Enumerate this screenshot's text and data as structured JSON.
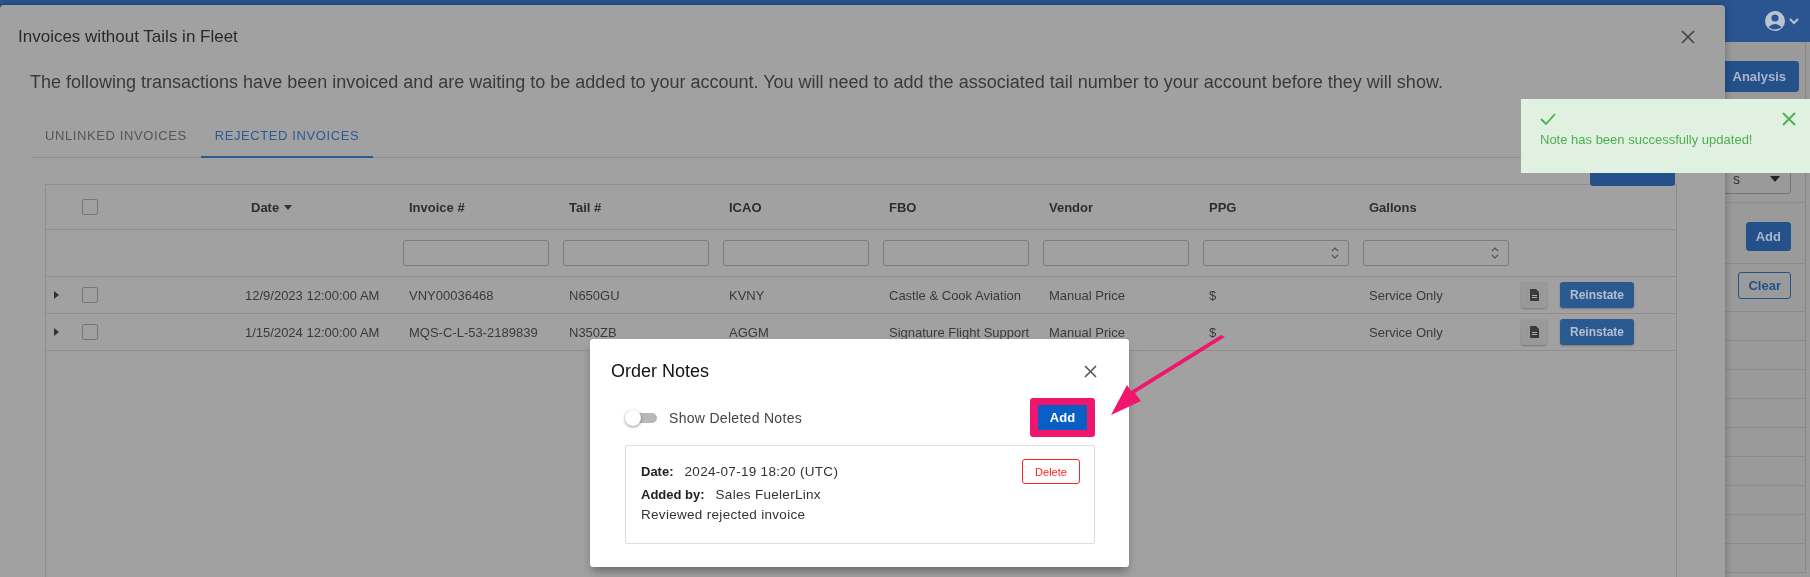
{
  "background_page": {
    "buttons": [
      {
        "label": "Analysis",
        "outlined": false
      },
      {
        "label": "Add",
        "outlined": false
      },
      {
        "label": "Clear",
        "outlined": true
      }
    ],
    "select": {
      "value": "s"
    }
  },
  "modal": {
    "title": "Invoices without Tails in Fleet",
    "description": "The following transactions have been invoiced and are waiting to be added to your account. You will need to add the associated tail number to your account before they will show.",
    "tabs": [
      {
        "label": "UNLINKED INVOICES",
        "selected": false
      },
      {
        "label": "REJECTED INVOICES",
        "selected": true
      }
    ],
    "table": {
      "header_checkbox": {
        "checked": false
      },
      "columns": [
        {
          "label": "Date",
          "sorted": true,
          "kind": "plain"
        },
        {
          "label": "Invoice #",
          "sorted": false,
          "kind": "text"
        },
        {
          "label": "Tail #",
          "sorted": false,
          "kind": "text"
        },
        {
          "label": "ICAO",
          "sorted": false,
          "kind": "text"
        },
        {
          "label": "FBO",
          "sorted": false,
          "kind": "text"
        },
        {
          "label": "Vendor",
          "sorted": false,
          "kind": "text"
        },
        {
          "label": "PPG",
          "sorted": false,
          "kind": "number"
        },
        {
          "label": "Gallons",
          "sorted": false,
          "kind": "number"
        }
      ],
      "rows": [
        {
          "expanded": false,
          "checked": false,
          "cells": [
            "12/9/2023 12:00:00 AM",
            "VNY00036468",
            "N650GU",
            "KVNY",
            "Castle & Cook Aviation",
            "Manual Price",
            "$",
            "Service Only"
          ],
          "action": "Reinstate"
        },
        {
          "expanded": false,
          "checked": false,
          "cells": [
            "1/15/2024 12:00:00 AM",
            "MQS-C-L-53-2189839",
            "N350ZB",
            "AGGM",
            "Signature Flight Support",
            "Manual Price",
            "$",
            "Service Only"
          ],
          "action": "Reinstate"
        }
      ]
    }
  },
  "toast": {
    "message": "Note has been successfully updated!"
  },
  "notes_dialog": {
    "title": "Order Notes",
    "show_deleted": {
      "label": "Show Deleted Notes",
      "on": false
    },
    "add_button": "Add",
    "notes": [
      {
        "date_label": "Date:",
        "date": "2024-07-19 18:20 (UTC)",
        "added_by_label": "Added by:",
        "added_by": "Sales FuelerLinx",
        "text": "Reviewed rejected invoice",
        "delete_button": "Delete"
      }
    ]
  }
}
